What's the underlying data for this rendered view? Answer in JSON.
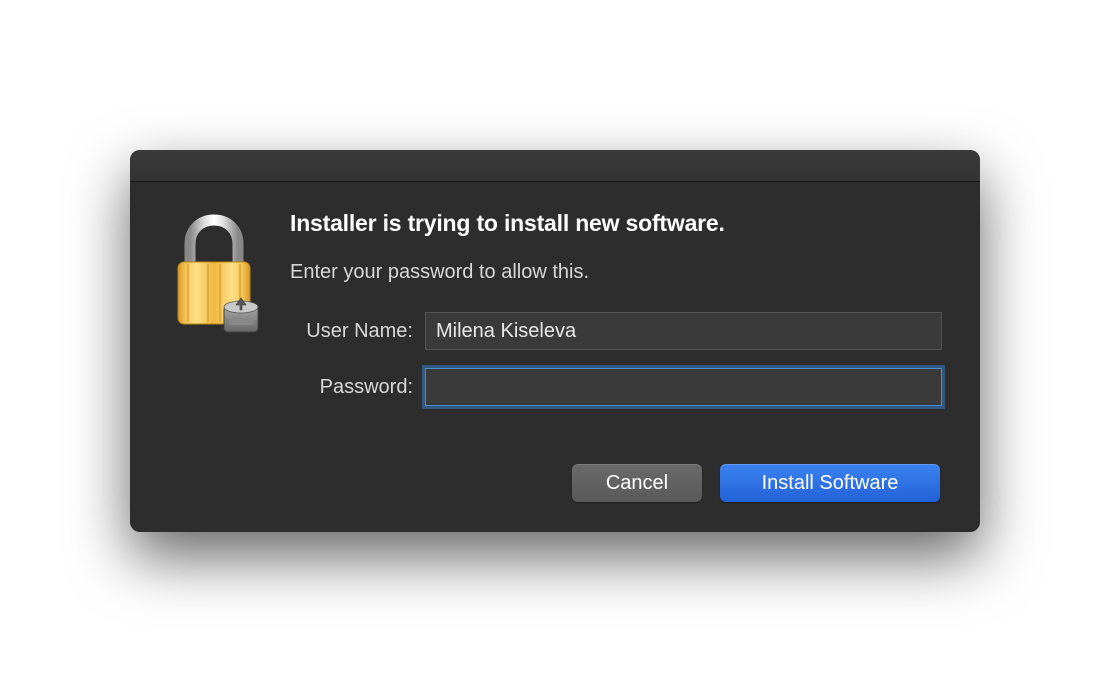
{
  "dialog": {
    "heading": "Installer is trying to install new software.",
    "subheading": "Enter your password to allow this.",
    "username_label": "User Name:",
    "username_value": "Milena Kiseleva",
    "password_label": "Password:",
    "password_value": "",
    "cancel_label": "Cancel",
    "confirm_label": "Install Software"
  },
  "colors": {
    "dialog_bg": "#2d2d2d",
    "primary_button": "#2668db",
    "focus_ring": "#4a90d9"
  }
}
